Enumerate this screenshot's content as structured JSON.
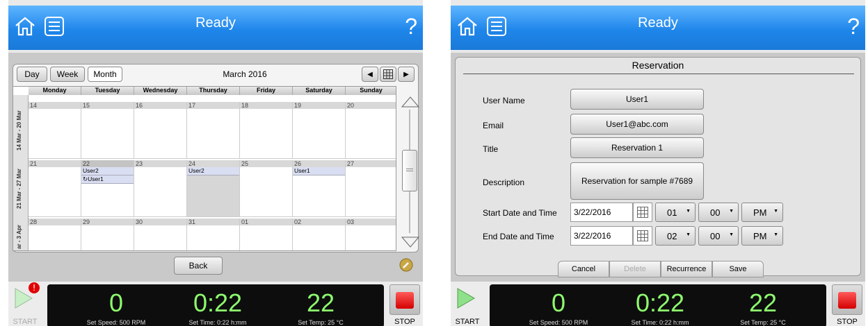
{
  "left": {
    "header": {
      "title": "Ready"
    },
    "toolbar": {
      "day": "Day",
      "week": "Week",
      "month": "Month",
      "month_title": "March 2016"
    },
    "columns": [
      "Monday",
      "Tuesday",
      "Wednesday",
      "Thursday",
      "Friday",
      "Saturday",
      "Sunday"
    ],
    "weeks": [
      {
        "label": "14 Mar - 20 Mar",
        "days": [
          "14",
          "15",
          "16",
          "17",
          "18",
          "19",
          "20"
        ]
      },
      {
        "label": "21 Mar - 27 Mar",
        "days": [
          "21",
          "22",
          "23",
          "24",
          "25",
          "26",
          "27"
        ]
      },
      {
        "label": "ar - 3 Apr",
        "days": [
          "28",
          "29",
          "30",
          "31",
          "01",
          "02",
          "03"
        ]
      }
    ],
    "events": {
      "tue1": "User2",
      "tue2": "↻User1",
      "thu1": "User2",
      "sat1": "User1"
    },
    "back": "Back",
    "status": {
      "speed": "0",
      "speed_label": "Set Speed: 500 RPM",
      "time": "0:22",
      "time_label": "Set Time: 0:22 h:mm",
      "temp": "22",
      "temp_label": "Set Temp: 25 °C"
    },
    "start": "START",
    "stop": "STOP"
  },
  "right": {
    "header": {
      "title": "Ready"
    },
    "form_title": "Reservation",
    "fields": {
      "user_name_label": "User Name",
      "user_name": "User1",
      "email_label": "Email",
      "email": "User1@abc.com",
      "title_label": "Title",
      "title": "Reservation 1",
      "description_label": "Description",
      "description": "Reservation for sample #7689",
      "start_label": "Start Date and Time",
      "start_date": "3/22/2016",
      "start_hour": "01",
      "start_min": "00",
      "start_ampm": "PM",
      "end_label": "End Date and Time",
      "end_date": "3/22/2016",
      "end_hour": "02",
      "end_min": "00",
      "end_ampm": "PM"
    },
    "actions": {
      "cancel": "Cancel",
      "delete": "Delete",
      "recurrence": "Recurrence",
      "save": "Save"
    },
    "status": {
      "speed": "0",
      "speed_label": "Set Speed: 500 RPM",
      "time": "0:22",
      "time_label": "Set Time: 0:22 h:mm",
      "temp": "22",
      "temp_label": "Set Temp: 25 °C"
    },
    "start": "START",
    "stop": "STOP"
  },
  "colors": {
    "accent": "#1f86ea",
    "status_value": "#8dfa6e",
    "stop_red": "#d40000"
  }
}
